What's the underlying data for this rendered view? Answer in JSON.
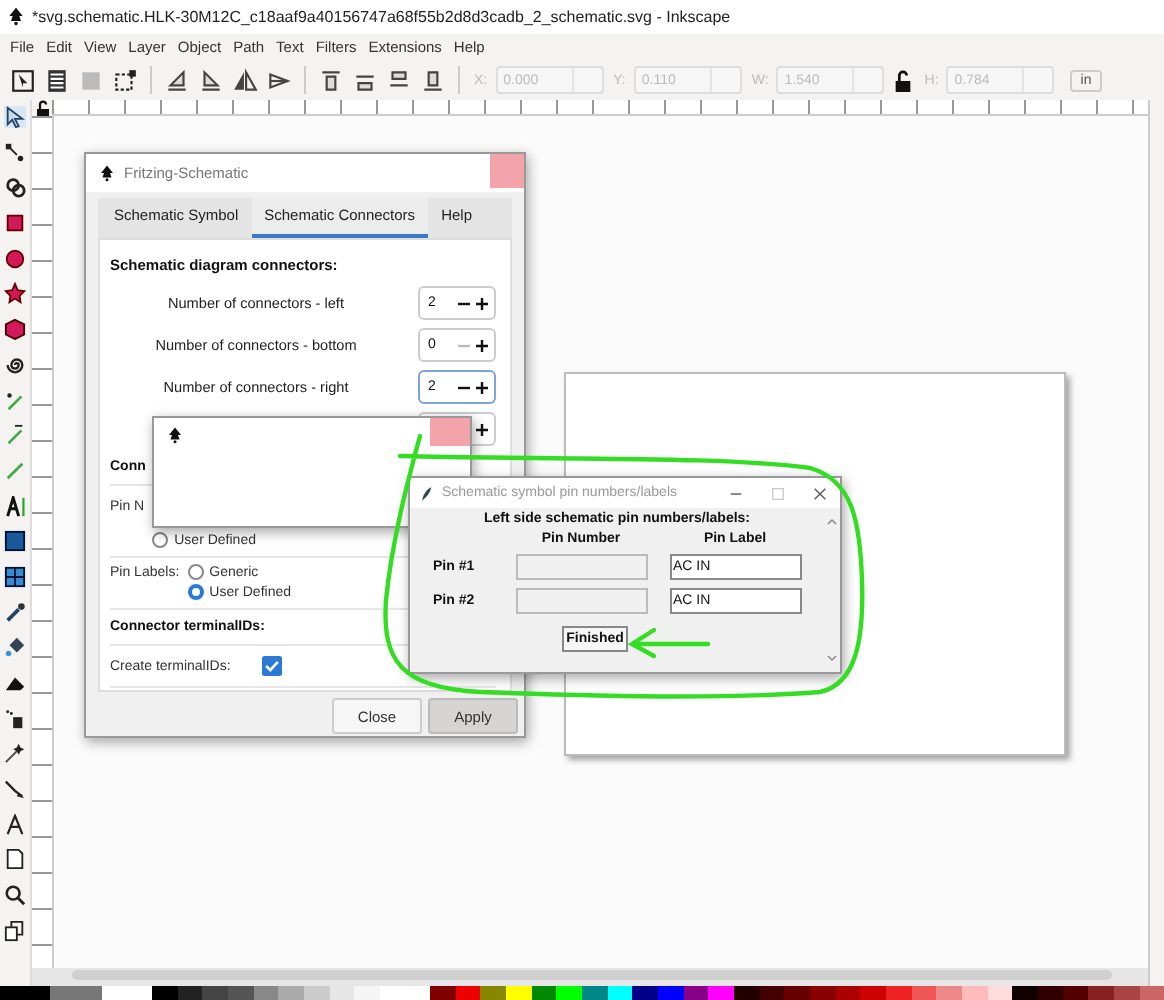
{
  "window": {
    "title": "*svg.schematic.HLK-30M12C_c18aaf9a40156747a68f55b2d8d3cadb_2_schematic.svg - Inkscape"
  },
  "menu": [
    "File",
    "Edit",
    "View",
    "Layer",
    "Object",
    "Path",
    "Text",
    "Filters",
    "Extensions",
    "Help"
  ],
  "toolbar": {
    "fields": [
      {
        "label": "X:",
        "value": "0.000",
        "disabled": true
      },
      {
        "label": "Y:",
        "value": "0.110",
        "disabled": true
      },
      {
        "label": "W:",
        "value": "1.540",
        "disabled": true
      },
      {
        "label": "H:",
        "value": "0.784",
        "disabled": true
      }
    ],
    "unit": "in"
  },
  "fritzing_dialog": {
    "title": "Fritzing-Schematic",
    "tabs": [
      {
        "label": "Schematic Symbol",
        "selected": false
      },
      {
        "label": "Schematic Connectors",
        "selected": true
      },
      {
        "label": "Help",
        "selected": false
      }
    ],
    "heading": "Schematic diagram connectors:",
    "spinners": [
      {
        "label": "Number of connectors - left",
        "value": "2",
        "minus_enabled": true,
        "focused": false
      },
      {
        "label": "Number of connectors - bottom",
        "value": "0",
        "minus_enabled": false,
        "focused": false
      },
      {
        "label": "Number of connectors - right",
        "value": "2",
        "minus_enabled": true,
        "focused": true
      },
      {
        "focused": false
      }
    ],
    "sections": [
      {
        "kind": "heading",
        "text": "Conn"
      },
      {
        "kind": "radios",
        "label": "Pin N",
        "options": [
          {
            "label": "User Defined",
            "selected": false
          }
        ]
      },
      {
        "kind": "radios",
        "label": "Pin Labels:",
        "options": [
          {
            "label": "Generic",
            "selected": false
          },
          {
            "label": "User Defined",
            "selected": true
          }
        ]
      },
      {
        "kind": "heading",
        "text": "Connector terminalIDs:"
      },
      {
        "kind": "checkbox",
        "label": "Create terminalIDs:",
        "checked": true
      }
    ],
    "buttons": [
      {
        "label": "Close",
        "pressed": false
      },
      {
        "label": "Apply",
        "pressed": true
      }
    ]
  },
  "pin_dialog": {
    "title": "Schematic symbol pin numbers/labels",
    "heading": "Left side schematic pin numbers/labels:",
    "columns": [
      "Pin Number",
      "Pin Label"
    ],
    "rows": [
      {
        "label": "Pin #1",
        "pin_label": "AC IN"
      },
      {
        "label": "Pin #2",
        "pin_label": "AC IN"
      }
    ],
    "button": "Finished"
  }
}
